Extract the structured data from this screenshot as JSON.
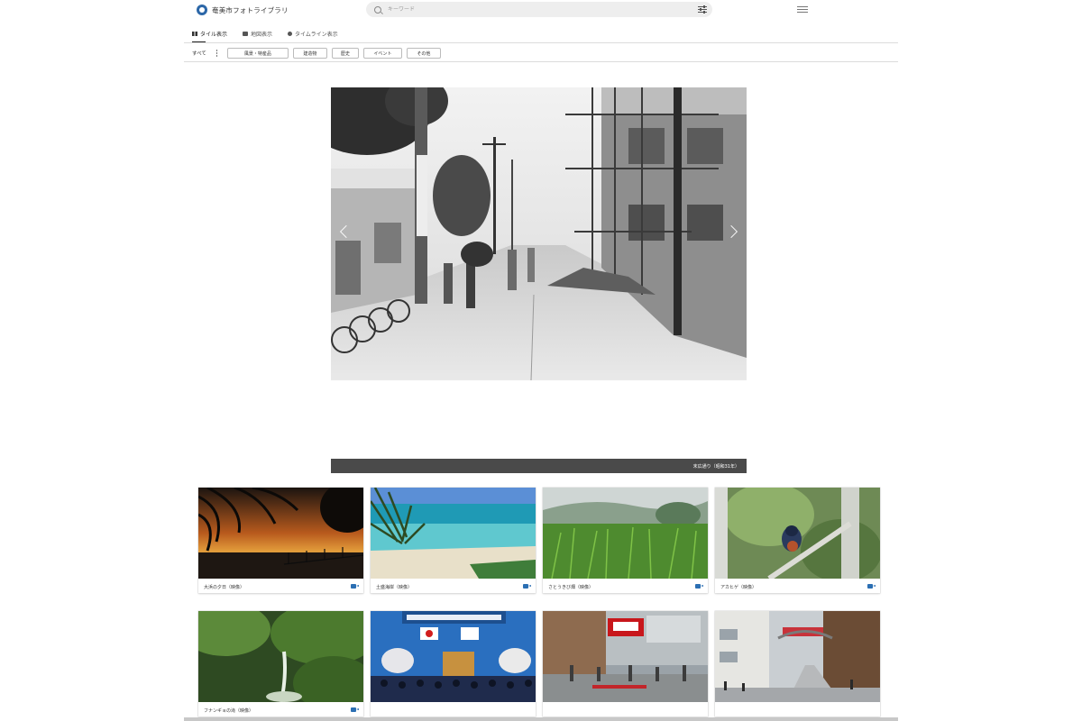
{
  "app": {
    "title": "奄美市フォトライブラリ"
  },
  "search": {
    "placeholder": "キーワード"
  },
  "icons": {
    "logo": "logo-icon",
    "search": "search-icon",
    "filter": "sliders-icon",
    "menu": "hamburger-menu-icon",
    "tile_view": "grid-icon",
    "map_view": "map-icon",
    "timeline_view": "clock-icon",
    "more": "kebab-icon",
    "prev": "chevron-left-icon",
    "next": "chevron-right-icon",
    "video": "video-camera-icon"
  },
  "view_tabs": [
    {
      "label": "タイル表示",
      "active": true
    },
    {
      "label": "地図表示",
      "active": false
    },
    {
      "label": "タイムライン表示",
      "active": false
    }
  ],
  "categories": {
    "all_label": "すべて",
    "chips": [
      "風景・特産品",
      "建造物",
      "歴史",
      "イベント",
      "その他"
    ]
  },
  "hero": {
    "caption": "末広通り（昭和31年）"
  },
  "tiles": [
    {
      "label": "大浜の夕日（映像）",
      "type": "video"
    },
    {
      "label": "土盛海岸（映像）",
      "type": "video"
    },
    {
      "label": "さとうきび畑（映像）",
      "type": "video"
    },
    {
      "label": "アカヒゲ（映像）",
      "type": "video"
    },
    {
      "label": "フナンギョの滝（映像）",
      "type": "video"
    },
    {
      "label": "",
      "type": "photo"
    },
    {
      "label": "",
      "type": "photo"
    },
    {
      "label": "",
      "type": "photo"
    }
  ],
  "colors": {
    "accent": "#2b6fb3",
    "caption_bar": "#4a4a4a",
    "search_bg": "#eeeeee"
  }
}
